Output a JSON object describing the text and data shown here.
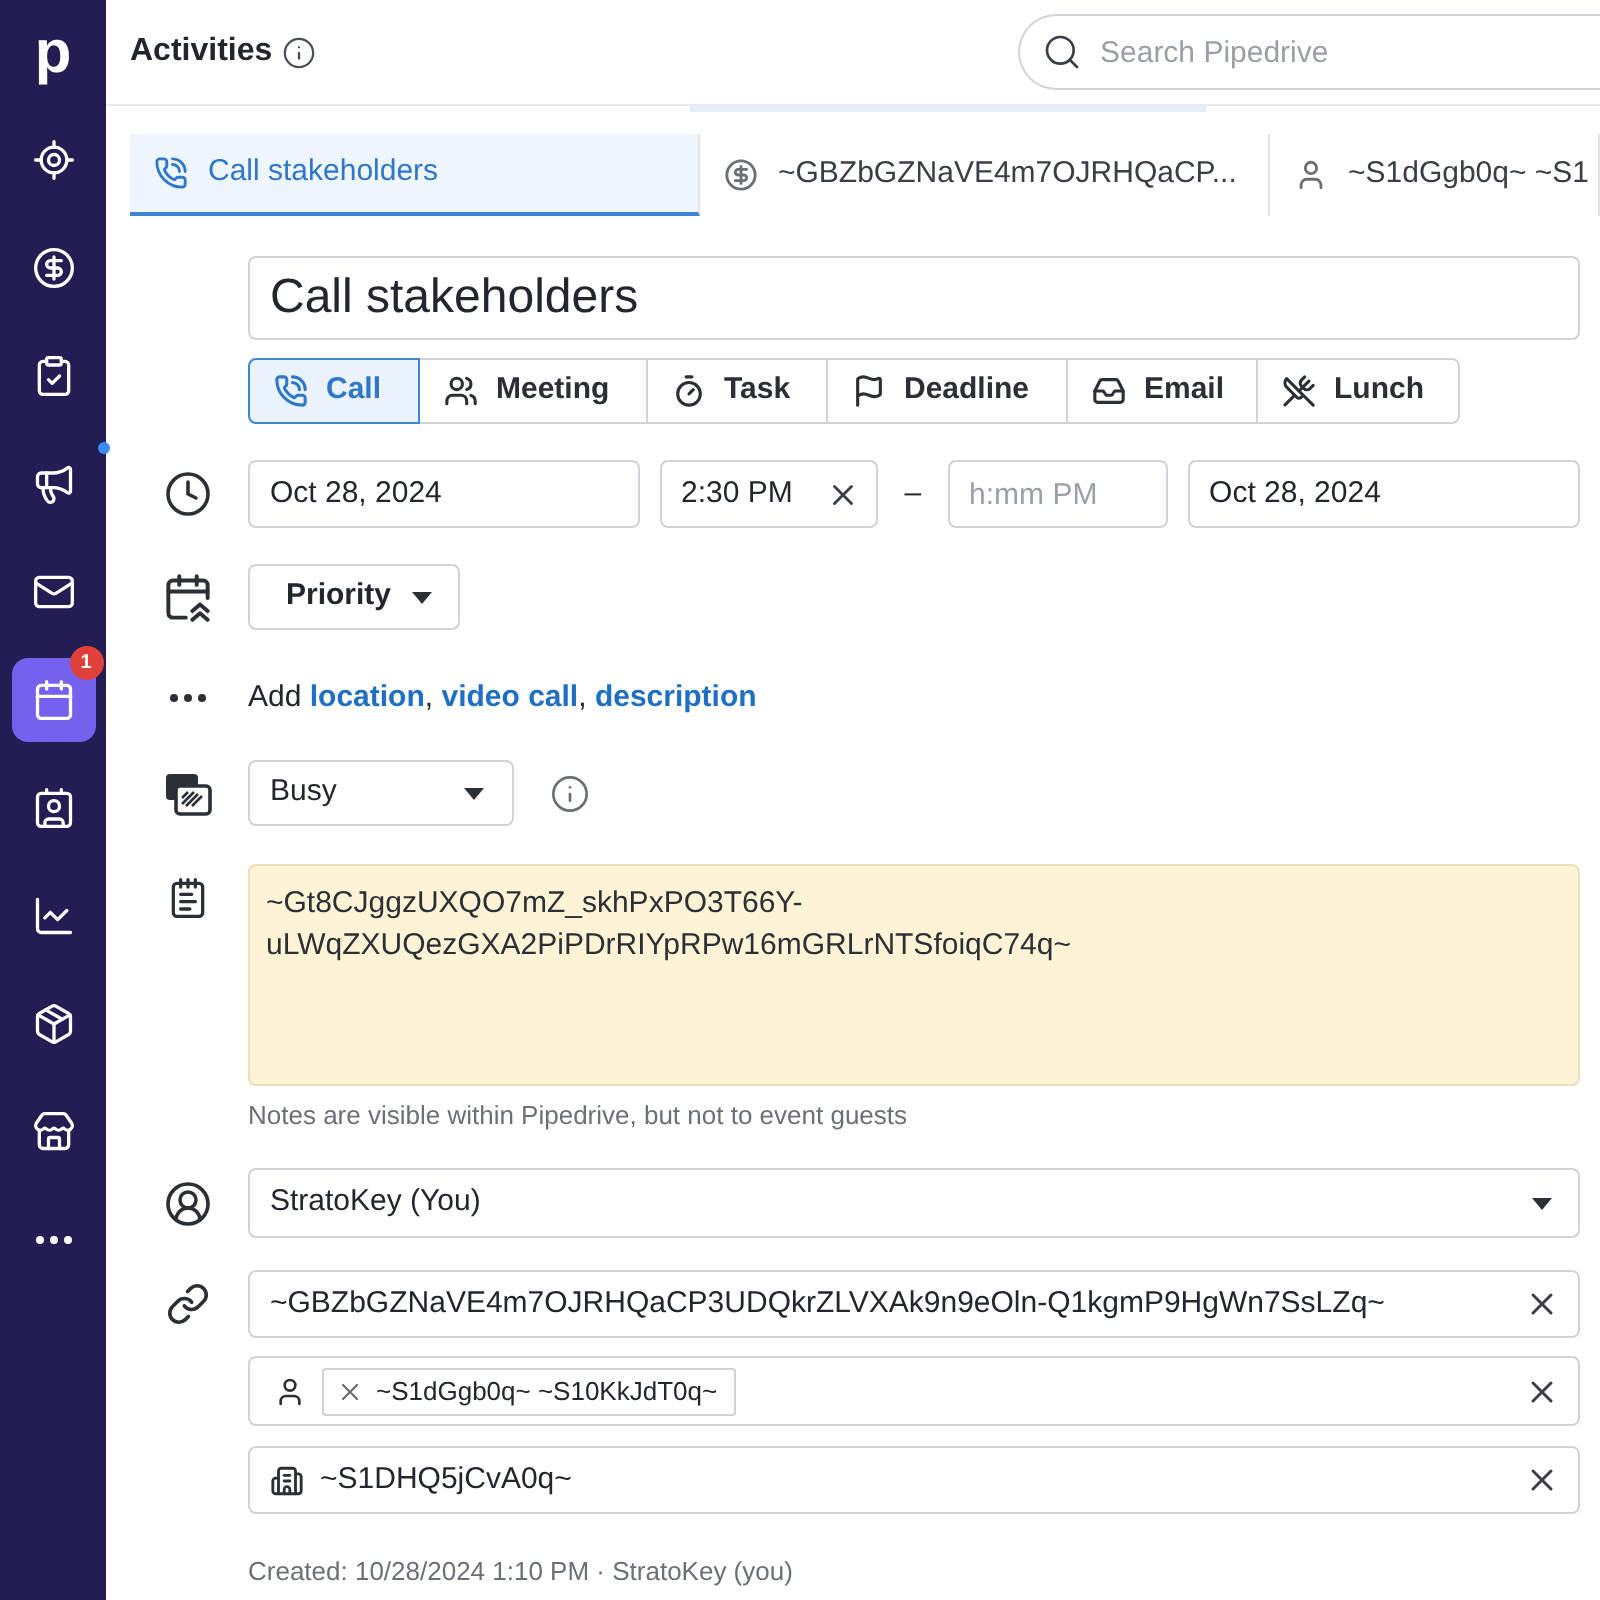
{
  "sidebar": {
    "logo": "p",
    "items": [
      {
        "selected": false,
        "unread_dot": false
      },
      {
        "selected": false,
        "unread_dot": false
      },
      {
        "selected": false,
        "unread_dot": false
      },
      {
        "selected": false,
        "unread_dot": true
      },
      {
        "selected": false,
        "unread_dot": false
      },
      {
        "selected": true,
        "unread_dot": false,
        "badge": "1"
      },
      {
        "selected": false,
        "unread_dot": false
      },
      {
        "selected": false,
        "unread_dot": false
      },
      {
        "selected": false,
        "unread_dot": false
      },
      {
        "selected": false,
        "unread_dot": false
      },
      {
        "selected": false,
        "unread_dot": false
      }
    ]
  },
  "header": {
    "title": "Activities",
    "search": {
      "placeholder": "Search Pipedrive"
    }
  },
  "tabs": [
    {
      "kind": "activity",
      "label": "Call stakeholders",
      "selected": true
    },
    {
      "kind": "deal",
      "label": "~GBZbGZNaVE4m7OJRHQaCP...",
      "selected": false
    },
    {
      "kind": "person",
      "label": "~S1dGgb0q~ ~S1",
      "selected": false
    }
  ],
  "form": {
    "title": {
      "value": "Call stakeholders"
    },
    "activity_types": [
      {
        "label": "Call",
        "selected": true
      },
      {
        "label": "Meeting",
        "selected": false
      },
      {
        "label": "Task",
        "selected": false
      },
      {
        "label": "Deadline",
        "selected": false
      },
      {
        "label": "Email",
        "selected": false
      },
      {
        "label": "Lunch",
        "selected": false
      }
    ],
    "schedule": {
      "start_date": "Oct 28, 2024",
      "start_time": "2:30 PM",
      "separator": "–",
      "end_time": {
        "placeholder": "h:mm PM"
      },
      "end_date": "Oct 28, 2024"
    },
    "priority": {
      "label": "Priority"
    },
    "add_details": {
      "prefix": "Add",
      "separator": ",",
      "links": [
        "location",
        "video call",
        "description"
      ]
    },
    "availability": {
      "value": "Busy"
    },
    "note": {
      "value": "~Gt8CJggzUXQO7mZ_skhPxPO3T66Y-uLWqZXUQezGXA2PiPDrRIYpRPw16mGRLrNTSfoiqC74q~",
      "hint": "Notes are visible within Pipedrive, but not to event guests"
    },
    "owner": {
      "value": "StratoKey (You)"
    },
    "deal": {
      "value": "~GBZbGZNaVE4m7OJRHQaCP3UDQkrZLVXAk9n9eOln-Q1kgmP9HgWn7SsLZq~"
    },
    "person": {
      "chips": [
        "~S1dGgb0q~ ~S10KkJdT0q~"
      ]
    },
    "organization": {
      "value": "~S1DHQ5jCvA0q~"
    },
    "footer": "Created: 10/28/2024 1:10 PM · StratoKey (you)"
  }
}
